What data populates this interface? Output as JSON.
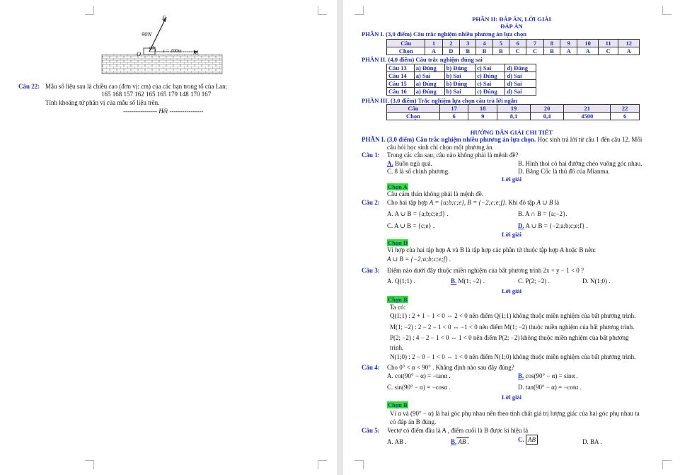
{
  "page1": {
    "figure": {
      "force": "90N",
      "vec_F": "F",
      "angle": "60°",
      "distance": "s = 100m",
      "pt_O": "O",
      "pt_M": "M"
    },
    "q22": {
      "label": "Câu 22:",
      "text": "Mẫu số liệu sau là chiều cao (đơn vị: cm) của các bạn trong tổ của Lan:",
      "data": "165 168 157 162 165 165 179 148 170 167",
      "ask": "Tính khoảng tứ phân vị của mẫu số liệu trên.",
      "end": "---------------- Hết ----------------"
    }
  },
  "page2": {
    "title1": "PHẦN II: ĐÁP ÁN, LỜI GIẢI",
    "title2": "ĐÁP ÁN",
    "p1_head": "PHẦN I. (3,0 điểm) Câu trắc nghiệm nhiều phương án lựa chọn",
    "t1": {
      "h": [
        "Câu",
        "1",
        "2",
        "3",
        "4",
        "5",
        "6",
        "7",
        "8",
        "9",
        "10",
        "11",
        "12"
      ],
      "r": [
        "Chọn",
        "A",
        "D",
        "B",
        "B",
        "B",
        "C",
        "C",
        "B",
        "A",
        "A",
        "C",
        "A"
      ]
    },
    "p2_head": "PHẦN II. (4,0 điểm) Câu trắc nghiệm đúng sai",
    "t2": [
      [
        "Câu 13",
        "a) Đúng",
        "b) Đúng",
        "c) Sai",
        "d) Đúng"
      ],
      [
        "Câu 14",
        "a) Sai",
        "b) Sai",
        "c) Đúng",
        "d) Sai"
      ],
      [
        "Câu 15",
        "a) Đúng",
        "b) Đúng",
        "c) Sai",
        "d) Sai"
      ],
      [
        "Câu 16",
        "a) Đúng",
        "b) Sai",
        "c) Đúng",
        "d) Sai"
      ]
    ],
    "p3_head": "PHẦN III. (3,0 điểm) Trắc nghiệm lựa chọn câu trả lời ngắn",
    "t3": {
      "h": [
        "Câu",
        "17",
        "18",
        "19",
        "20",
        "21",
        "22"
      ],
      "r": [
        "Chọn",
        "6",
        "9",
        "8,1",
        "0,4",
        "4500",
        "6"
      ]
    },
    "guide": "HƯỚNG DẪN GIẢI CHI TIẾT",
    "g1a": "PHẦN I. (3,0 điểm) Câu trắc nghiệm nhiều phương án lựa chọn.",
    "g1b": " Học sinh trả lời từ câu 1 đến câu 12. Mỗi",
    "g1c": "câu hỏi học sinh chỉ chọn một phương án.",
    "loigiai": "Lời giải",
    "q1": {
      "n": "Câu 1:",
      "t": "Trong các câu sau, câu nào không phải là mệnh đề?",
      "A": "A.",
      "Atx": " Buồn ngủ quá.",
      "B": "B. Hình thoi có hai đường chéo vuông góc nhau.",
      "C": "C. 8 là số chính phương.",
      "D": "D. Băng Cốc là thủ đô của Mianma.",
      "chon": "Chọn A",
      "sol": "Câu cảm thán không phải là mệnh đề."
    },
    "q2": {
      "n": "Câu 2:",
      "t1": "Cho hai tập hợp ",
      "m1": "A = {a;b;c;e}",
      "t2": ", ",
      "m2": "B = {−2;c;e;f}",
      "t3": ". Khi đó tập ",
      "m3": "A ∪ B",
      "t4": " là",
      "A": "A. A ∪ B = {a;b;c;e;f} .",
      "B": "B. A ∩ B = {a;−2}.",
      "C": "C. A ∪ B = {c;e} .",
      "D": "D.",
      "Dtx": " A ∪ B = {−2;a;b;c;e;f} .",
      "chon": "Chọn D",
      "sol1": "Vì hợp của hai tập hợp A  và B  là tập hợp các phần tử thuộc tập hợp A  hoặc B  nên:",
      "sol2": "A ∪ B = {−2;a;b;c;e;f} ."
    },
    "q3": {
      "n": "Câu 3:",
      "t": "Điểm nào dưới đây thuộc miền nghiệm của bất phương trình  2x + y − 1 < 0 ?",
      "A": "A. Q(1;1) .",
      "B": "B.",
      "Btx": " M(1; −2) .",
      "C": "C. P(2; −2) .",
      "D": "D. N(1;0) .",
      "chon": "Chọn B",
      "taco": "Ta có:",
      "l1": "Q(1;1) : 2 + 1 − 1 < 0 ⇔ 2 < 0  nên điểm Q(1;1)  không thuộc miền nghiệm của bất phương trình.",
      "l2": "M(1; −2) : 2 − 2 − 1 < 0 ⇔ −1 < 0  nên điểm  M(1; −2)  thuộc miền nghiệm của bất phương trình.",
      "l3": "P(2; −2) : 4 − 2 − 1 < 0 ⇔ 1 < 0  nên điểm  P(2; −2)  không thuộc miền nghiệm của bất phương",
      "l3b": "trình.",
      "l4": "N(1;0) : 2 − 0 − 1 < 0 ⇔ 1 < 0  nên điểm  N(1;0)  không thuộc miền nghiệm của bất phương trình."
    },
    "q4": {
      "n": "Câu 4:",
      "t": "Cho 0° < α < 90° . Khẳng định nào sau đây đúng?",
      "A": "A. cot(90° − α) = −tanα .",
      "B": "B.",
      "Btx": " cos(90° − α) = sinα .",
      "C": "C. sin(90° − α) = −cosα .",
      "D": "D. tan(90° − α) = −cotα .",
      "chon": "Chọn B",
      "sol1": "Vì α  và (90° − α) là hai góc phụ nhau nên theo tính chất giá trị lượng giác của hai góc phụ nhau ta",
      "sol2": "có đáp án B đúng."
    },
    "q5": {
      "n": "Câu 5:",
      "t": "Vectơ có điểm đầu là A , điểm cuối là  B được kí hiệu là",
      "A": "A. AB .",
      "B": "B.",
      "Btx": " AB .",
      "C": "C.",
      "Ctx": "AB",
      "D": "D. BA ."
    }
  }
}
